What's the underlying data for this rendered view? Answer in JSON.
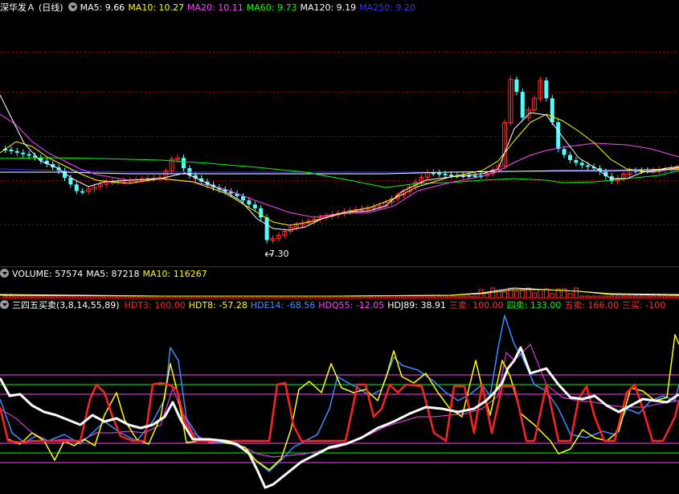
{
  "price_header": {
    "stock_name": "深华发Ａ",
    "period": "(日线)",
    "ma": [
      {
        "label": "MA5: 9.66",
        "color": "#ffffff"
      },
      {
        "label": "MA10: 10.27",
        "color": "#ffff00"
      },
      {
        "label": "MA20: 10.11",
        "color": "#ff44ff"
      },
      {
        "label": "MA60: 9.73",
        "color": "#00ff00"
      },
      {
        "label": "MA120: 9.19",
        "color": "#ffffff"
      },
      {
        "label": "MA250: 9.20",
        "color": "#3333ff"
      }
    ]
  },
  "price_low_label": "7.30",
  "volume_header": {
    "items": [
      {
        "label": "VOLUME: 57574",
        "color": "#ffffff"
      },
      {
        "label": "MA5: 87218",
        "color": "#ffffff"
      },
      {
        "label": "MA10: 116267",
        "color": "#ffff00"
      }
    ]
  },
  "indicator_header": {
    "name": "三四五买卖(3,8,14,55,89)",
    "items": [
      {
        "label": "HDT3: 100.00",
        "color": "#ff2222"
      },
      {
        "label": "HDT8: -57.28",
        "color": "#ffff00"
      },
      {
        "label": "HDE14: -68.56",
        "color": "#3a8fff"
      },
      {
        "label": "HDQ55: -12.05",
        "color": "#ff44ff"
      },
      {
        "label": "HDJ89: 38.91",
        "color": "#ffffff"
      },
      {
        "label": "三卖: 100.00",
        "color": "#ff3030"
      },
      {
        "label": "四卖: 133.00",
        "color": "#00ff00"
      },
      {
        "label": "五卖: 166.00",
        "color": "#ff3030"
      },
      {
        "label": "三买: -100",
        "color": "#ff3030"
      }
    ]
  },
  "colors": {
    "up": "#ff3030",
    "down": "#54fcfc",
    "separator": "#b00000",
    "grid": "#a00000"
  }
}
